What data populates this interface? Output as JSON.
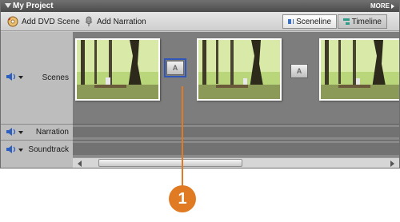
{
  "window": {
    "title": "My Project",
    "more_label": "MORE"
  },
  "toolbar": {
    "add_dvd_scene": "Add DVD Scene",
    "add_narration": "Add Narration",
    "sceneline": "Sceneline",
    "timeline": "Timeline",
    "active_view": "Sceneline"
  },
  "tracks": {
    "scenes": "Scenes",
    "narration": "Narration",
    "soundtrack": "Soundtrack"
  },
  "transition_glyph": "A",
  "callout": {
    "number": "1",
    "color": "#e07b24"
  },
  "colors": {
    "selection_outline": "#2f56b8",
    "title_bar": "#555555"
  },
  "icons": [
    "dvd-disc-icon",
    "microphone-icon",
    "sceneline-icon",
    "timeline-icon",
    "speaker-icon"
  ]
}
